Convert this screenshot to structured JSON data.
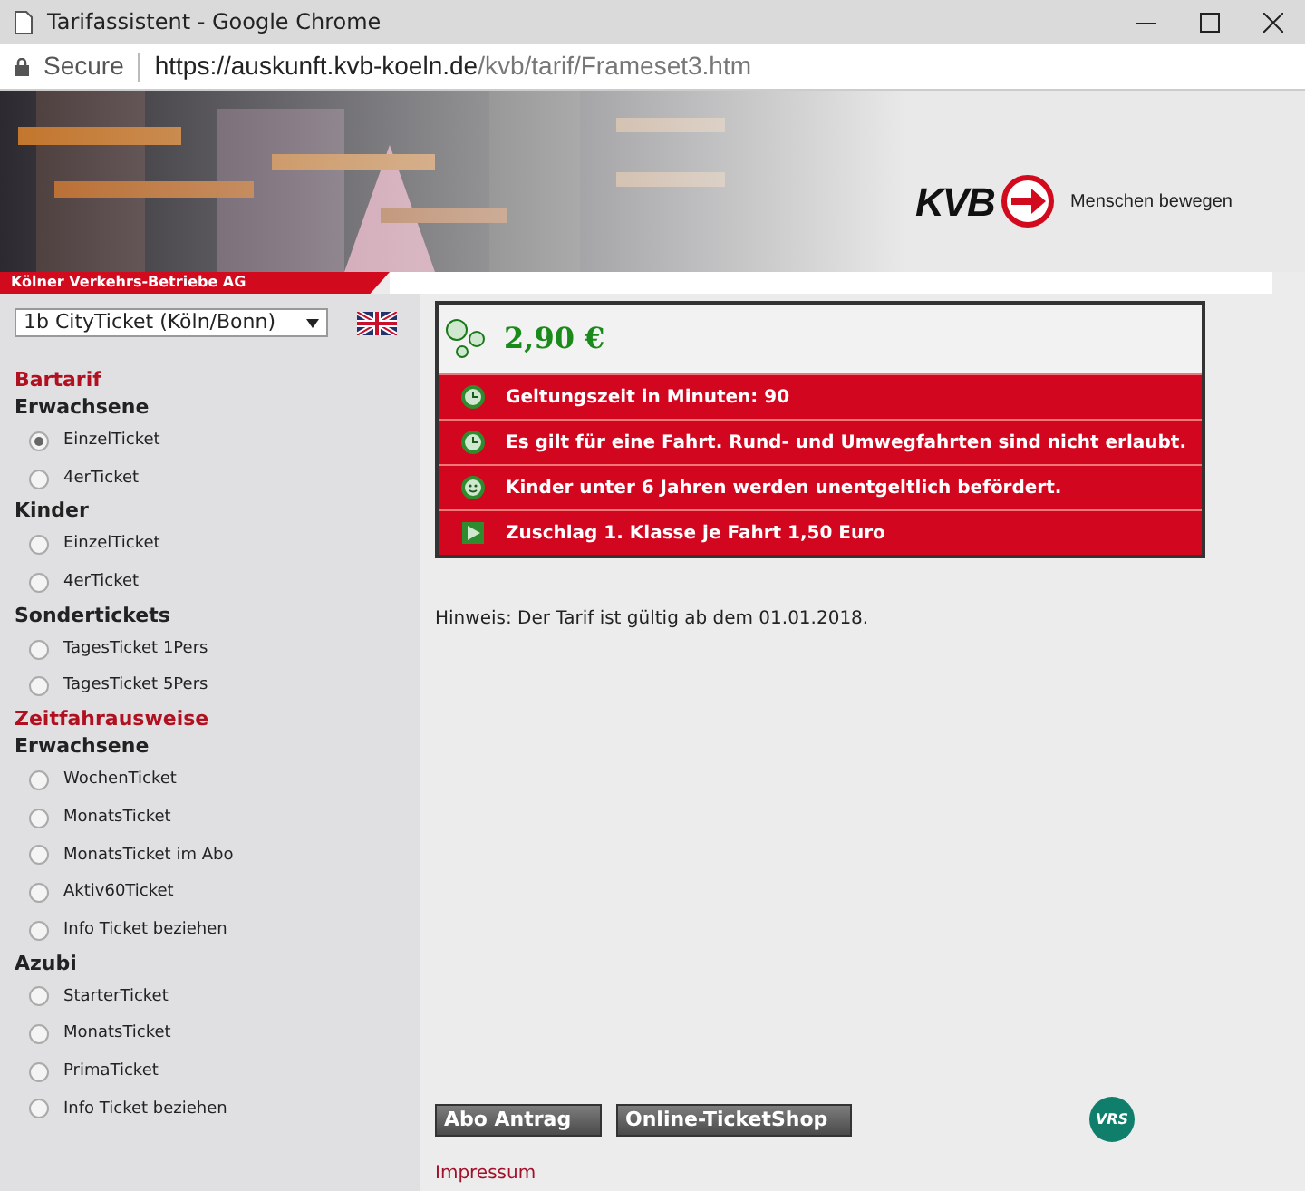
{
  "window": {
    "title": "Tarifassistent - Google Chrome"
  },
  "address_bar": {
    "security": "Secure",
    "url_host": "https://auskunft.kvb-koeln.de",
    "url_path": "/kvb/tarif/Frameset3.htm"
  },
  "header": {
    "logo": "KVB",
    "slogan": "Menschen bewegen",
    "company": "Kölner Verkehrs-Betriebe AG"
  },
  "sidebar": {
    "select_value": "1b CityTicket (Köln/Bonn)",
    "items": [
      {
        "kind": "category",
        "label": "Bartarif"
      },
      {
        "kind": "group",
        "label": "Erwachsene"
      },
      {
        "kind": "option",
        "label": "EinzelTicket",
        "selected": true
      },
      {
        "kind": "option",
        "label": "4erTicket",
        "selected": false
      },
      {
        "kind": "group",
        "label": "Kinder"
      },
      {
        "kind": "option",
        "label": "EinzelTicket",
        "selected": false
      },
      {
        "kind": "option",
        "label": "4erTicket",
        "selected": false
      },
      {
        "kind": "group",
        "label": "Sondertickets"
      },
      {
        "kind": "option",
        "label": "TagesTicket 1Pers",
        "selected": false
      },
      {
        "kind": "option",
        "label": "TagesTicket 5Pers",
        "selected": false
      },
      {
        "kind": "category",
        "label": "Zeitfahrausweise"
      },
      {
        "kind": "group",
        "label": "Erwachsene"
      },
      {
        "kind": "option",
        "label": "WochenTicket",
        "selected": false
      },
      {
        "kind": "option",
        "label": "MonatsTicket",
        "selected": false
      },
      {
        "kind": "option",
        "label": "MonatsTicket im Abo",
        "selected": false
      },
      {
        "kind": "option",
        "label": "Aktiv60Ticket",
        "selected": false
      },
      {
        "kind": "option",
        "label": "Info Ticket beziehen",
        "selected": false
      },
      {
        "kind": "group",
        "label": "Azubi"
      },
      {
        "kind": "option",
        "label": "StarterTicket",
        "selected": false
      },
      {
        "kind": "option",
        "label": "MonatsTicket",
        "selected": false
      },
      {
        "kind": "option",
        "label": "PrimaTicket",
        "selected": false
      },
      {
        "kind": "option",
        "label": "Info Ticket beziehen",
        "selected": false
      }
    ]
  },
  "tariff": {
    "price": "2,90 €",
    "rows": [
      {
        "kind": "time",
        "text": "Geltungszeit in Minuten: 90"
      },
      {
        "kind": "time",
        "text": "Es gilt für eine Fahrt. Rund- und Umwegfahrten sind nicht erlaubt."
      },
      {
        "kind": "child",
        "text": "Kinder unter 6 Jahren werden unentgeltlich befördert."
      },
      {
        "kind": "surcharge",
        "text": "Zuschlag 1. Klasse je Fahrt 1,50 Euro"
      }
    ]
  },
  "notice": "Hinweis: Der Tarif ist gültig ab dem 01.01.2018.",
  "buttons": [
    "Abo Antrag",
    "Online-TicketShop"
  ],
  "vrs_logo": "VRS",
  "footer_link": "Impressum"
}
